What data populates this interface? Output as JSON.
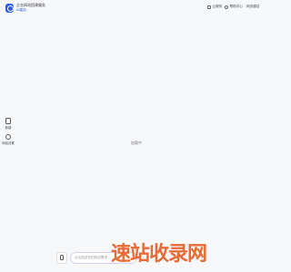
{
  "header": {
    "brand_title": "企业网站搭建服务",
    "brand_sub": "AI建站",
    "nav": [
      {
        "label": "云服务",
        "icon": "cloud-icon"
      },
      {
        "label": "帮助中心",
        "icon": "user-icon"
      },
      {
        "label": "网页建站"
      }
    ]
  },
  "sidebar": {
    "items": [
      {
        "label": "新建",
        "icon": "new-document-icon"
      },
      {
        "label": "网站设置",
        "icon": "settings-icon"
      }
    ]
  },
  "main": {
    "empty_label": "加载中"
  },
  "chat": {
    "placeholder": "点击描述您的网站需求"
  },
  "watermark": {
    "text": "速站收录网"
  }
}
